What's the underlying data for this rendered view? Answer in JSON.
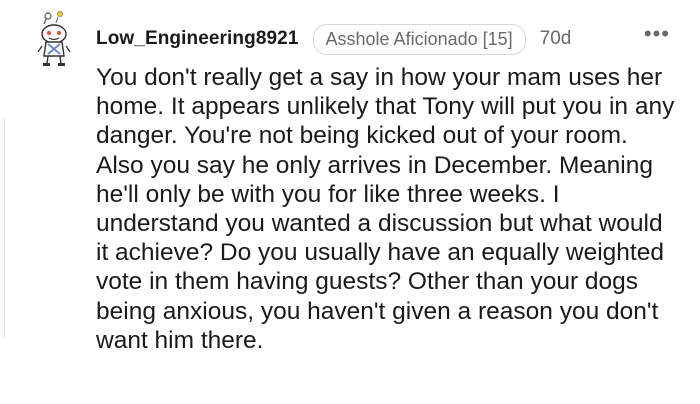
{
  "comment": {
    "username": "Low_Engineering8921",
    "flair": "Asshole Aficionado [15]",
    "timestamp": "70d",
    "more_icon": "more-horizontal-icon",
    "avatar_icon": "snoo-avatar-icon",
    "body": "You don't really get a say in how your mam uses her home. It appears unlikely that Tony will put you in any danger. You're not being kicked out of your room. Also you say he only arrives in December. Meaning he'll only be with you for like three weeks. I understand you wanted a discussion but what would it achieve? Do you usually have an equally weighted vote in them having guests? Other than your dogs being anxious, you haven't given a reason you don't want him there."
  },
  "colors": {
    "text": "#1a1a1b",
    "meta": "#6a6a6a",
    "flair_border": "#d7d7d7",
    "background": "#ffffff"
  }
}
